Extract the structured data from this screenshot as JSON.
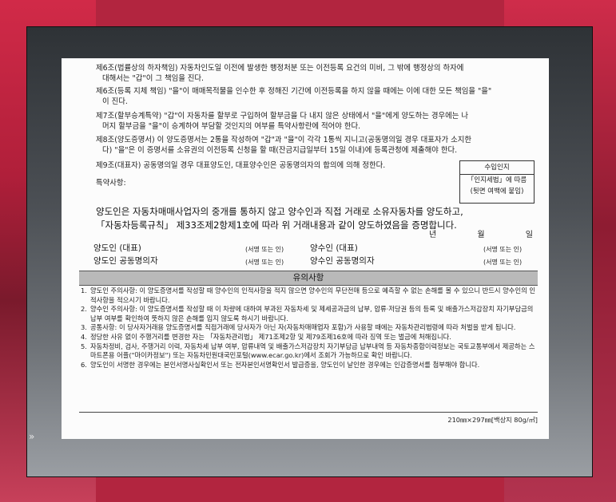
{
  "background": {
    "frame_color": "#3e4246",
    "side_color": "#b2253f"
  },
  "dash_icon": "»",
  "clauses": [
    {
      "l1": "제6조(법률상의 하자책임) 자동차인도일 이전에 발생한 행정처분 또는 이전등록 요건의 미비, 그 밖에 행정상의 하자에",
      "l2": "대해서는 \"갑\"이 그 책임을 진다."
    },
    {
      "l1": "제6조(등록 지체 책임) \"을\"이 매매목적물을 인수한 후 정해진 기간에 이전등록을 하지 않을 때에는 이에 대한 모든 책임을 \"을\"",
      "l2": "이 진다."
    },
    {
      "l1": "제7조(할부승계특약) \"갑\"이 자동차를 할부로 구입하여 할부금을 다 내지 않은 상태에서 \"을\"에게 양도하는 경우에는 나",
      "l2": "머지 할부금을 \"을\"이 승계하여 부담할 것인지의 여부를 특약사항란에 적어야 한다."
    },
    {
      "l1": "제8조(양도증명서) 이 양도증명서는 2통을 작성하여 \"갑\"과 \"을\"이 각각 1통씩 지니고(공동명의일 경우 대표자가 소지한",
      "l2": "다) \"을\"은 이 증명서를 소유권의 이전등록 신청을 할 때(잔금지급일부터 15일 이내)에 등록관청에 제출해야 한다."
    },
    {
      "l1": "제9조(대표자) 공동명의일 경우 대표양도인, 대표양수인은 공동명의자의 합의에 의해 정한다.",
      "l2": ""
    }
  ],
  "seal_box": {
    "header": "수입인지",
    "line1": "「인지세법」에 따름",
    "line2": "(뒷면 여백에 붙임)"
  },
  "special_terms_label": "특약사항:",
  "statement": {
    "line1": "양도인은 자동차매매사업자의 중개를 통하지 않고 양수인과 직접 거래로 소유자동차를 양도하고,",
    "line2": "「자동차등록규칙」 제33조제2항제1호에 따라 위 거래내용과 같이 양도하였음을 증명합니다."
  },
  "date": {
    "year": "년",
    "month": "월",
    "day": "일"
  },
  "signatures": [
    {
      "left": "양도인 (대표)",
      "left_sign": "(서명 또는 인)",
      "right": "양수인 (대표)",
      "right_sign": "(서명 또는 인)"
    },
    {
      "left": "양도인 공동명의자",
      "left_sign": "(서명 또는 인)",
      "right": "양수인 공동명의자",
      "right_sign": "(서명 또는 인)"
    }
  ],
  "notice_title": "유의사항",
  "notes": [
    {
      "n": "1.",
      "text": "양도인 주의사항: 이 양도증명서를 작성할 때 양수인의 인적사항을 적지 않으면 양수인의 무단전매 등으로 예측할 수 없는 손해를 볼 수 있으니 반드시 양수인의 인적사항을 적으시기 바랍니다."
    },
    {
      "n": "2.",
      "text": "양수인 주의사항: 이 양도증명서를 작성할 때 이 차량에 대하여 부과된 자동차세 및 제세공과금의 납부, 압류·저당권 등의 등록 및 배출가스저감장치 자기부담금의 납부 여부를 확인하여 뜻하지 않은 손해를 입지 않도록 하시기 바랍니다."
    },
    {
      "n": "3.",
      "text": "공통사항: 이 당사자거래용 양도증명서를 직접거래에 당사자가 아닌 자(자동차매매업자 포함)가 사용할 때에는 자동차관리법령에 따라 처벌을 받게 됩니다."
    },
    {
      "n": "4.",
      "text": "정당한 사유 없이 주행거리를 변경한 자는 「자동차관리법」 제71조제2항 및 제79조제16호에 따라 징역 또는 벌금에 처해집니다."
    },
    {
      "n": "5.",
      "text": "자동차정비, 검사, 주행거리 이력, 자동차세 납부 여부, 압류내역 및 배출가스저감장치 자기부담금 납부내역 등 자동차종합이력정보는 국토교통부에서 제공하는 스마트폰용 어플(\"마이카정보\") 또는 자동차민원대국민포털(www.ecar.go.kr)에서 조회가 가능하므로 확인 바랍니다."
    },
    {
      "n": "6.",
      "text": "양도인이 서명한 경우에는 본인서명사실확인서 또는 전자본인서명확인서 발급증을, 양도인이 날인한 경우에는 인감증명서를 첨부해야 합니다."
    }
  ],
  "footer": "210㎜×297㎜[백상지 80g/㎡]"
}
